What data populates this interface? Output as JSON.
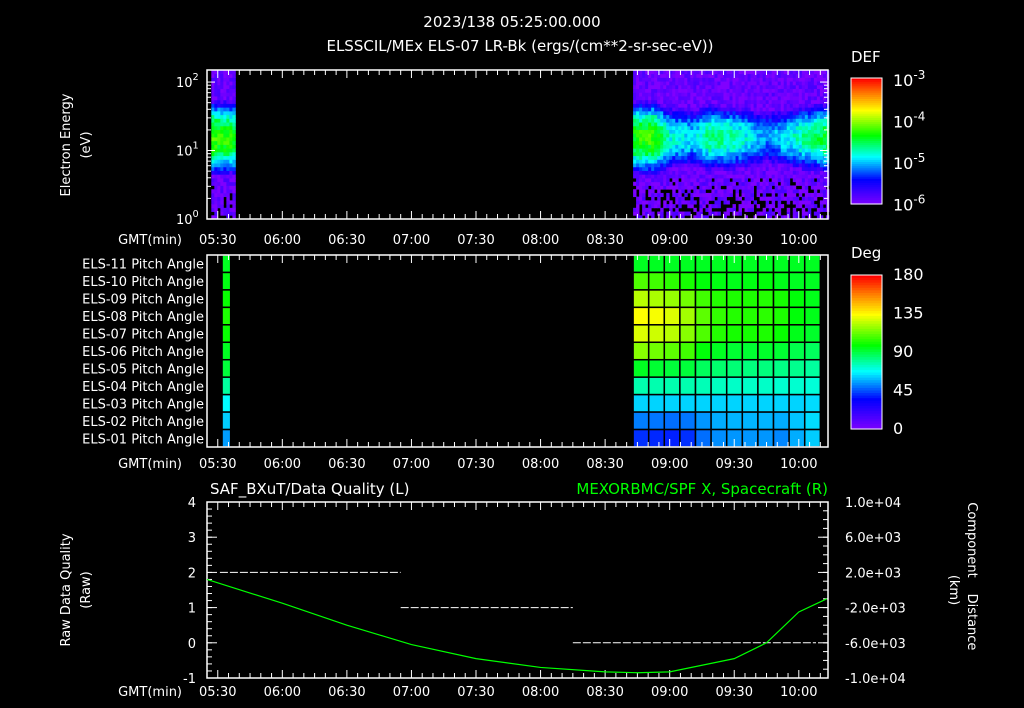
{
  "header": {
    "datetime": "2023/138 05:25:00.000",
    "subtitle": "ELSSCIL/MEx ELS-07 LR-Bk  (ergs/(cm**2-sr-sec-eV))"
  },
  "colors": {
    "background": "#000000",
    "text": "#ffffff",
    "orbit_line": "#00ff00",
    "quality_line": "#ffffff"
  },
  "chart_data": [
    {
      "type": "heatmap",
      "name": "electron-energy-spectrogram",
      "ylabel": [
        "Electron Energy",
        "(eV)"
      ],
      "xlabel": "GMT(min)",
      "yscale": "log",
      "ylim_eV": [
        1,
        150
      ],
      "yticks": [
        {
          "base": "10",
          "exp": "0",
          "value": 1
        },
        {
          "base": "10",
          "exp": "1",
          "value": 10
        },
        {
          "base": "10",
          "exp": "2",
          "value": 100
        }
      ],
      "time_range": [
        "05:25",
        "10:13"
      ],
      "time_ticks": [
        "05:30",
        "06:00",
        "06:30",
        "07:00",
        "07:30",
        "08:00",
        "08:30",
        "09:00",
        "09:30",
        "10:00"
      ],
      "data_intervals": [
        [
          "05:27",
          "05:37"
        ],
        [
          "08:43",
          "10:13"
        ]
      ],
      "band_peak_energy_eV": 15,
      "band_peak_log_def_profile": [
        [
          "05:27",
          -4.2
        ],
        [
          "05:37",
          -4.3
        ],
        [
          "08:43",
          -4.3
        ],
        [
          "08:52",
          -4.2
        ],
        [
          "09:00",
          -4.8
        ],
        [
          "09:10",
          -4.9
        ],
        [
          "09:18",
          -4.6
        ],
        [
          "09:30",
          -4.7
        ],
        [
          "09:45",
          -5.1
        ],
        [
          "10:00",
          -4.7
        ],
        [
          "10:13",
          -4.4
        ]
      ],
      "colorbar": {
        "title": "DEF",
        "scale": "log",
        "range": [
          1e-06,
          0.001
        ],
        "ticks": [
          {
            "base": "10",
            "exp": "-3"
          },
          {
            "base": "10",
            "exp": "-4"
          },
          {
            "base": "10",
            "exp": "-5"
          },
          {
            "base": "10",
            "exp": "-6"
          }
        ]
      }
    },
    {
      "type": "heatmap",
      "name": "pitch-angle-panel",
      "xlabel": "GMT(min)",
      "rows": [
        "ELS-11 Pitch Angle",
        "ELS-10 Pitch Angle",
        "ELS-09 Pitch Angle",
        "ELS-08 Pitch Angle",
        "ELS-07 Pitch Angle",
        "ELS-06 Pitch Angle",
        "ELS-05 Pitch Angle",
        "ELS-04 Pitch Angle",
        "ELS-03 Pitch Angle",
        "ELS-02 Pitch Angle",
        "ELS-01 Pitch Angle"
      ],
      "time_ticks": [
        "05:30",
        "06:00",
        "06:30",
        "07:00",
        "07:30",
        "08:00",
        "08:30",
        "09:00",
        "09:30",
        "10:00"
      ],
      "blocks": [
        {
          "start": "05:32",
          "end": "05:36",
          "columns": 1,
          "values_deg": [
            [
              95
            ],
            [
              97
            ],
            [
              100
            ],
            [
              103
            ],
            [
              100
            ],
            [
              95
            ],
            [
              92
            ],
            [
              80
            ],
            [
              68
            ],
            [
              62
            ],
            [
              56
            ]
          ]
        },
        {
          "start": "08:43",
          "end": "10:10",
          "columns": 12,
          "values_deg": [
            [
              95,
              95,
              95,
              95,
              95,
              95,
              95,
              95,
              95,
              95,
              95,
              95
            ],
            [
              110,
              108,
              105,
              102,
              98,
              97,
              96,
              97,
              98,
              96,
              95,
              95
            ],
            [
              125,
              123,
              120,
              115,
              108,
              104,
              103,
              103,
              104,
              102,
              98,
              96
            ],
            [
              135,
              134,
              130,
              122,
              112,
              106,
              104,
              104,
              105,
              103,
              98,
              96
            ],
            [
              130,
              128,
              125,
              118,
              110,
              104,
              102,
              102,
              103,
              100,
              96,
              94
            ],
            [
              118,
              115,
              112,
              108,
              98,
              95,
              93,
              93,
              94,
              93,
              90,
              88
            ],
            [
              95,
              93,
              92,
              92,
              88,
              86,
              85,
              84,
              84,
              83,
              82,
              80
            ],
            [
              78,
              78,
              78,
              78,
              77,
              76,
              75,
              75,
              75,
              74,
              74,
              73
            ],
            [
              63,
              63,
              63,
              63,
              63,
              63,
              63,
              63,
              63,
              63,
              63,
              64
            ],
            [
              52,
              51,
              50,
              51,
              55,
              58,
              59,
              59,
              59,
              58,
              61,
              64
            ],
            [
              42,
              41,
              40,
              42,
              50,
              54,
              55,
              55,
              55,
              53,
              58,
              62
            ]
          ]
        }
      ],
      "colorbar": {
        "title": "Deg",
        "range": [
          0,
          180
        ],
        "ticks": [
          "180",
          "135",
          "90",
          "45",
          "0"
        ]
      }
    },
    {
      "type": "line",
      "name": "quality-and-orbit-panel",
      "title_left": "SAF_BXuT/Data Quality (L)",
      "title_right": "MEXORBMC/SPF X, Spacecraft (R)",
      "ylabel_left": [
        "Raw Data Quality",
        "(Raw)"
      ],
      "ylabel_right": [
        "Component",
        "Distance",
        "(km)"
      ],
      "xlabel": "GMT(min)",
      "ylim_left": [
        -1,
        4
      ],
      "yticks_left": [
        "4",
        "3",
        "2",
        "1",
        "0",
        "-1"
      ],
      "ylim_right": [
        -10000,
        10000
      ],
      "yticks_right": [
        "1.0e+04",
        "6.0e+03",
        "2.0e+03",
        "-2.0e+03",
        "-6.0e+03",
        "-1.0e+04"
      ],
      "time_ticks": [
        "05:30",
        "06:00",
        "06:30",
        "07:00",
        "07:30",
        "08:00",
        "08:30",
        "09:00",
        "09:30",
        "10:00"
      ],
      "series": [
        {
          "name": "Data Quality",
          "axis": "left",
          "segments": [
            {
              "start": "05:31",
              "end": "06:55",
              "value": 2
            },
            {
              "start": "06:55",
              "end": "08:15",
              "value": 1
            },
            {
              "start": "08:15",
              "end": "10:08",
              "value": 0
            }
          ]
        },
        {
          "name": "SPF X, Spacecraft",
          "axis": "right",
          "points": [
            [
              "05:25",
              1200
            ],
            [
              "06:00",
              -1500
            ],
            [
              "06:30",
              -4000
            ],
            [
              "07:00",
              -6200
            ],
            [
              "07:30",
              -7800
            ],
            [
              "08:00",
              -8800
            ],
            [
              "08:30",
              -9300
            ],
            [
              "08:45",
              -9400
            ],
            [
              "09:00",
              -9300
            ],
            [
              "09:30",
              -7800
            ],
            [
              "09:45",
              -6000
            ],
            [
              "10:00",
              -2500
            ],
            [
              "10:13",
              -1000
            ]
          ]
        }
      ]
    }
  ]
}
